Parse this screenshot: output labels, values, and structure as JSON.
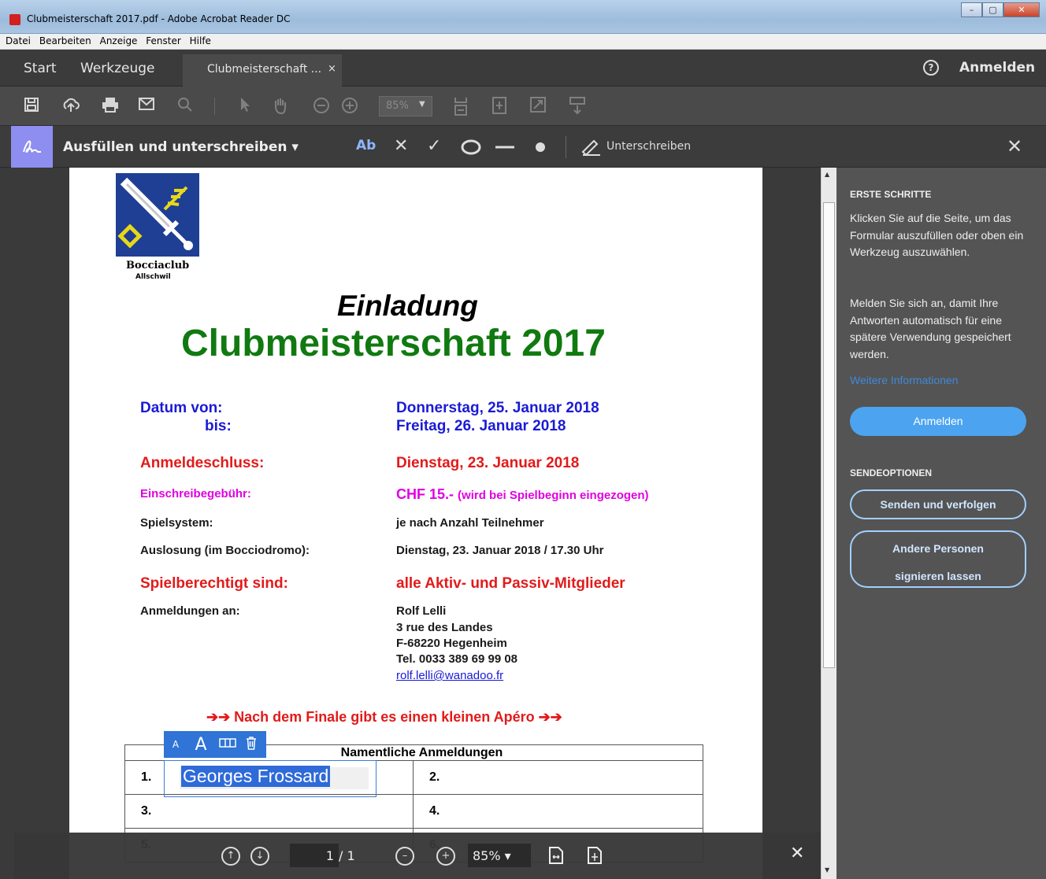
{
  "window": {
    "title": "Clubmeisterschaft 2017.pdf - Adobe Acrobat Reader DC",
    "min": "–",
    "max": "▢",
    "close": "✕"
  },
  "menu": [
    "Datei",
    "Bearbeiten",
    "Anzeige",
    "Fenster",
    "Hilfe"
  ],
  "tabs": {
    "start": "Start",
    "tools": "Werkzeuge",
    "doc": "Clubmeisterschaft ...",
    "doc_close": "×",
    "help": "?",
    "signin": "Anmelden"
  },
  "toolbar": {
    "zoom": "85%"
  },
  "fillsign": {
    "title": "Ausfüllen und unterschreiben ▾",
    "text_tool": "Ab",
    "sign_label": "Unterschreiben",
    "close": "✕"
  },
  "document": {
    "logo_name": "Bocciaclub",
    "logo_sub": "Allschwil",
    "heading": "Einladung",
    "title": "Clubmeisterschaft 2017",
    "rows": {
      "datum_von_label": "Datum  von:",
      "datum_bis_label": "bis:",
      "datum_von": "Donnerstag, 25. Januar  2018",
      "datum_bis": "Freitag, 26. Januar 2018",
      "anmeldeschluss_label": "Anmeldeschluss:",
      "anmeldeschluss": "Dienstag, 23. Januar 2018",
      "gebuehr_label": "Einschreibegebühr:",
      "gebuehr": "CHF 15.-",
      "gebuehr_note": "(wird bei Spielbeginn eingezogen)",
      "spielsystem_label": "Spielsystem:",
      "spielsystem": "je nach Anzahl Teilnehmer",
      "auslosung_label": "Auslosung (im Bocciodromo):",
      "auslosung": "Dienstag, 23. Januar 2018 / 17.30 Uhr",
      "berechtigt_label": "Spielberechtigt sind:",
      "berechtigt": "alle Aktiv- und Passiv-Mitglieder",
      "anmeldungen_label": "Anmeldungen an:",
      "contact_name": "Rolf Lelli",
      "contact_street": "3 rue des Landes",
      "contact_city": "F-68220 Hegenheim",
      "contact_tel": "Tel. 0033 389 69 99 08",
      "contact_email": "rolf.lelli@wanadoo.fr"
    },
    "apero": "➔➔ Nach dem Finale gibt es einen kleinen Apéro ➔➔",
    "table_header": "Namentliche Anmeldungen",
    "table_cells": [
      "1.",
      "2.",
      "3.",
      "4.",
      "5.",
      "6."
    ],
    "field_value": "Georges Frossard",
    "fieldbar": {
      "small_a": "A",
      "large_a": "A"
    }
  },
  "nav": {
    "page": "1",
    "total": "/  1",
    "zoom": "85%  ▾",
    "close": "✕"
  },
  "side": {
    "erste_heading": "ERSTE SCHRITTE",
    "erste_p1": "Klicken Sie auf die Seite, um das Formular auszufüllen oder oben ein Werkzeug auszuwählen.",
    "erste_p2": "Melden Sie sich an, damit Ihre Antworten automatisch für eine spätere Verwendung gespeichert werden.",
    "more_info": "Weitere Informationen",
    "signin_btn": "Anmelden",
    "send_heading": "SENDEOPTIONEN",
    "send_btn": "Senden und verfolgen",
    "others_line1": "Andere Personen",
    "others_line2": "signieren lassen"
  }
}
